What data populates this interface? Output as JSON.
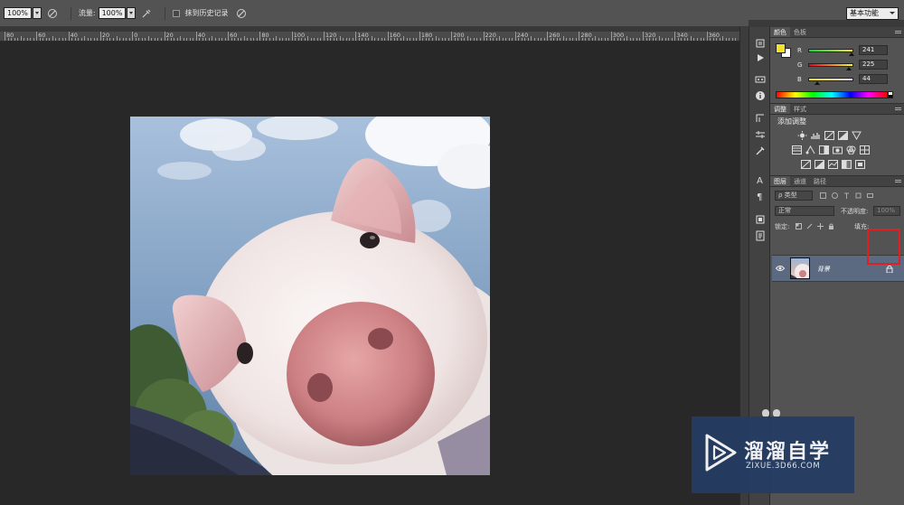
{
  "options_bar": {
    "opacity_value": "100%",
    "flow_label": "流量:",
    "flow_value": "100%",
    "history_label": "抹到历史记录",
    "workspace": "基本功能"
  },
  "ruler": {
    "labels": [
      "80",
      "60",
      "40",
      "20",
      "0",
      "20",
      "40",
      "60",
      "80",
      "100",
      "120",
      "140",
      "160",
      "180",
      "200",
      "220",
      "240",
      "260",
      "280",
      "300",
      "320",
      "340",
      "360"
    ]
  },
  "color_panel": {
    "tabs": [
      "颜色",
      "色板"
    ],
    "channels": [
      {
        "letter": "R",
        "value": "241",
        "level": 0.945
      },
      {
        "letter": "G",
        "value": "225",
        "level": 0.88
      },
      {
        "letter": "B",
        "value": "44",
        "level": 0.17
      }
    ],
    "foreground": "#f1e12c",
    "background": "#ffffff"
  },
  "adjust_panel": {
    "tabs": [
      "调整",
      "样式"
    ],
    "title": "添加调整"
  },
  "layers_panel": {
    "tabs": [
      "图层",
      "通道",
      "路径"
    ],
    "filter_label": "ρ 类型",
    "blend_mode": "正常",
    "opacity_label": "不透明度:",
    "opacity_value": "100%",
    "lock_label": "锁定:",
    "fill_label": "填充:",
    "layer_name": "背景"
  },
  "watermark": {
    "title": "溜溜自学",
    "url": "ZIXUE.3D66.COM"
  },
  "colors": {
    "accent_red": "#e02020",
    "panel": "#535353",
    "selected_layer": "#5b6a80",
    "watermark_bg": "#243c64"
  }
}
